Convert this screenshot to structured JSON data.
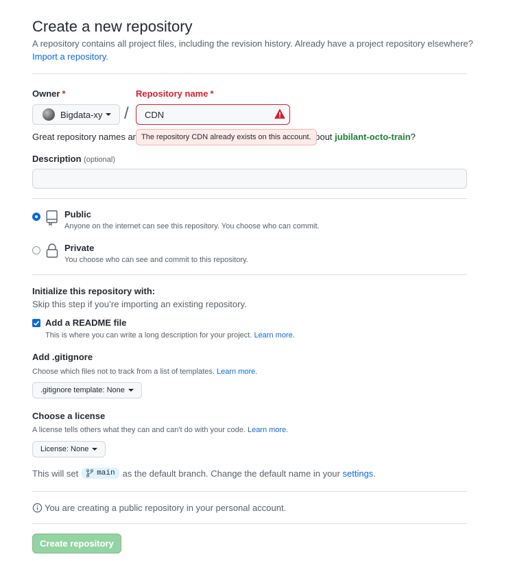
{
  "header": {
    "title": "Create a new repository",
    "subtitle": "A repository contains all project files, including the revision history. Already have a project repository elsewhere?",
    "import_link": "Import a repository."
  },
  "owner": {
    "label": "Owner",
    "required_mark": "*",
    "value": "Bigdata-xy",
    "separator": "/"
  },
  "repo_name": {
    "label": "Repository name",
    "required_mark": "*",
    "value": "CDN",
    "error_tooltip": "The repository CDN already exists on this account.",
    "hint_prefix": "Great repository names are",
    "hint_suffix": "about",
    "suggestion": "jubilant-octo-train",
    "suggestion_end": "?"
  },
  "description": {
    "label": "Description",
    "optional": "(optional)",
    "value": ""
  },
  "visibility": {
    "selected": "public",
    "options": [
      {
        "id": "public",
        "title": "Public",
        "desc": "Anyone on the internet can see this repository. You choose who can commit.",
        "icon": "repo-icon"
      },
      {
        "id": "private",
        "title": "Private",
        "desc": "You choose who can see and commit to this repository.",
        "icon": "lock-icon"
      }
    ]
  },
  "init": {
    "title": "Initialize this repository with:",
    "subtitle": "Skip this step if you’re importing an existing repository.",
    "readme": {
      "checked": true,
      "title": "Add a README file",
      "desc": "This is where you can write a long description for your project.",
      "learn_more": "Learn more."
    }
  },
  "gitignore": {
    "title": "Add .gitignore",
    "desc": "Choose which files not to track from a list of templates.",
    "learn_more": "Learn more.",
    "select_label": ".gitignore template: None"
  },
  "license": {
    "title": "Choose a license",
    "desc": "A license tells others what they can and can't do with your code.",
    "learn_more": "Learn more.",
    "select_label": "License: None"
  },
  "branch": {
    "prefix": "This will set",
    "name": "main",
    "middle": "as the default branch. Change the default name in your",
    "settings_link": "settings",
    "end": "."
  },
  "notice": {
    "text": "You are creating a public repository in your personal account."
  },
  "submit": {
    "label": "Create repository"
  },
  "colors": {
    "link": "#0969da",
    "error": "#cf222e",
    "success": "#1a7f37",
    "button_disabled": "#94d3a2"
  }
}
